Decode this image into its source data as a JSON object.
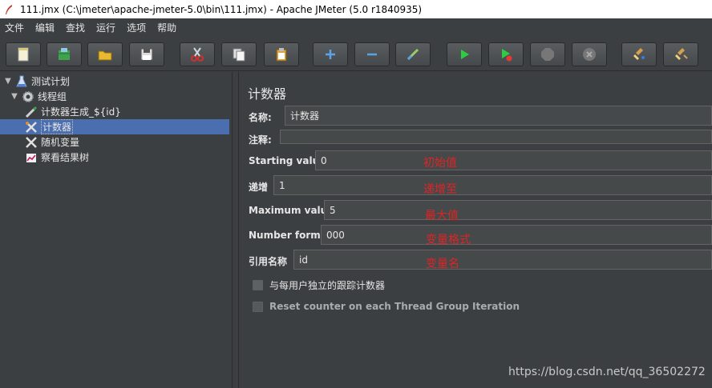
{
  "window": {
    "title": "111.jmx (C:\\jmeter\\apache-jmeter-5.0\\bin\\111.jmx) - Apache JMeter (5.0 r1840935)"
  },
  "menu": [
    "文件",
    "编辑",
    "查找",
    "运行",
    "选项",
    "帮助"
  ],
  "toolbar": {
    "buttons": [
      "new-icon",
      "templates-icon",
      "open-icon",
      "save-icon",
      "cut-icon",
      "copy-icon",
      "paste-icon",
      "expand-icon",
      "collapse-icon",
      "toggle-icon",
      "start-icon",
      "start-no-timers-icon",
      "stop-icon",
      "shutdown-icon",
      "clear-icon",
      "clear-all-icon"
    ]
  },
  "tree": {
    "items": [
      {
        "label": "测试计划",
        "icon": "test-plan-icon"
      },
      {
        "label": "线程组",
        "icon": "thread-group-icon"
      },
      {
        "label": "计数器生成_${id}",
        "icon": "sampler-icon"
      },
      {
        "label": "计数器",
        "icon": "config-element-icon"
      },
      {
        "label": "随机变量",
        "icon": "config-element-icon"
      },
      {
        "label": "察看结果树",
        "icon": "listener-icon"
      }
    ]
  },
  "panel": {
    "title": "计数器",
    "name_label": "名称:",
    "name_value": "计数器",
    "comment_label": "注释:",
    "start_label": "Starting value",
    "start_value": "0",
    "increment_label": "递增",
    "increment_value": "1",
    "max_label": "Maximum value",
    "max_value": "5",
    "format_label": "Number format",
    "format_value": "000",
    "ref_label": "引用名称",
    "ref_value": "id",
    "per_user_label": "与每用户独立的跟踪计数器",
    "reset_label": "Reset counter on each Thread Group Iteration"
  },
  "annotations": {
    "start": "初始值",
    "increment": "递增至",
    "max": "最大值",
    "format": "变量格式",
    "ref": "变量名"
  },
  "watermark": "https://blog.csdn.net/qq_36502272",
  "colors": {
    "annotation": "#e02424",
    "selection": "#4b6eaf",
    "background": "#3c3f41"
  }
}
